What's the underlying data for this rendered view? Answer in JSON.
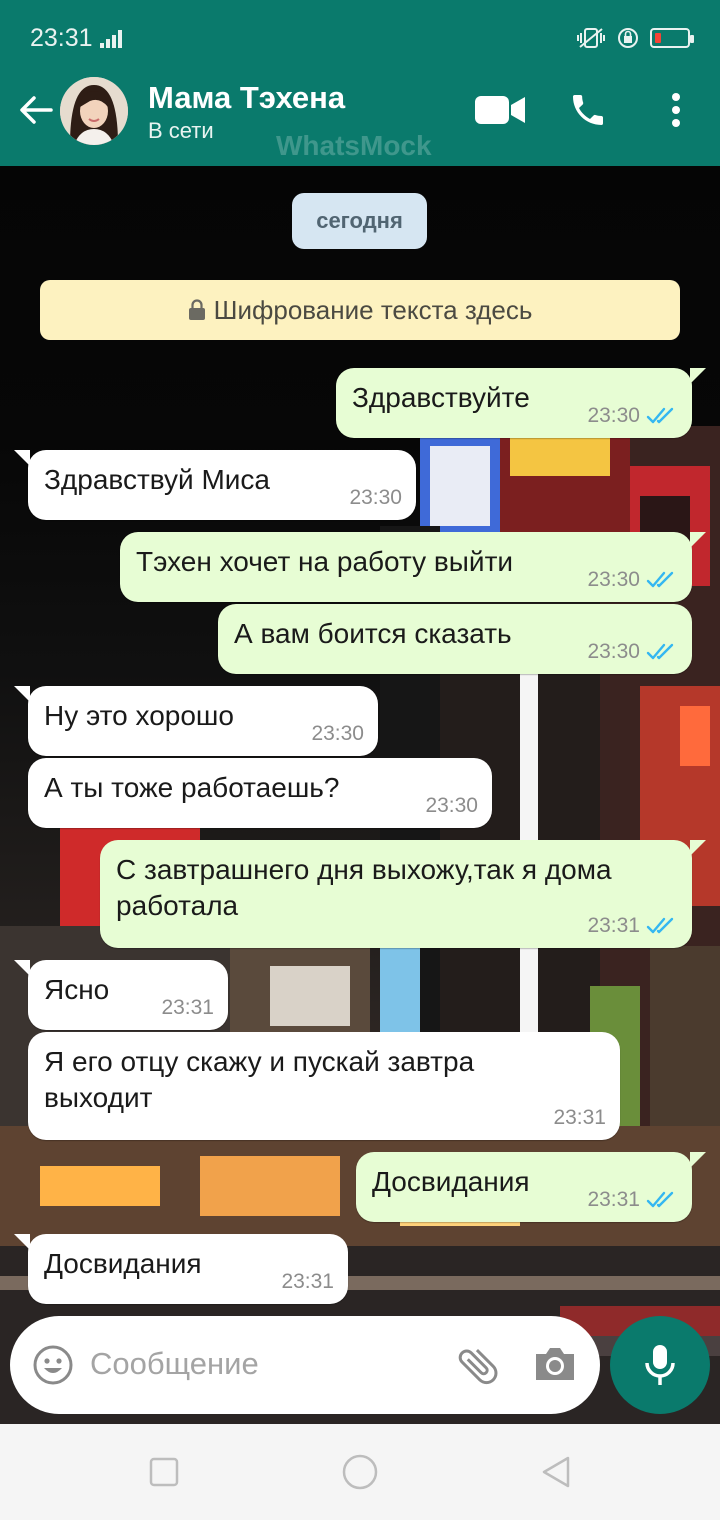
{
  "status_bar": {
    "time": "23:31"
  },
  "header": {
    "contact_name": "Мама Тэхена",
    "contact_status": "В сети",
    "watermark": "WhatsMock"
  },
  "chat": {
    "date_label": "сегодня",
    "encryption_notice": "Шифрование текста здесь",
    "messages": [
      {
        "dir": "out",
        "text": "Здравствуйте",
        "time": "23:30"
      },
      {
        "dir": "in",
        "text": "Здравствуй Миса",
        "time": "23:30"
      },
      {
        "dir": "out",
        "text": "Тэхен хочет на работу выйти",
        "time": "23:30"
      },
      {
        "dir": "out",
        "text": "А вам боится сказать",
        "time": "23:30"
      },
      {
        "dir": "in",
        "text": "Ну это хорошо",
        "time": "23:30"
      },
      {
        "dir": "in",
        "text": "А ты тоже работаешь?",
        "time": "23:30"
      },
      {
        "dir": "out",
        "text": "С завтрашнего дня выхожу,так я дома работала",
        "time": "23:31"
      },
      {
        "dir": "in",
        "text": "Ясно",
        "time": "23:31"
      },
      {
        "dir": "in",
        "text": "Я его отцу скажу и пускай завтра выходит",
        "time": "23:31"
      },
      {
        "dir": "out",
        "text": "Досвидания",
        "time": "23:31"
      },
      {
        "dir": "in",
        "text": "Досвидания",
        "time": "23:31"
      }
    ]
  },
  "input": {
    "placeholder": "Сообщение"
  },
  "colors": {
    "header": "#0a7a6c",
    "outgoing_bubble": "#e7fdd4",
    "incoming_bubble": "#ffffff",
    "read_ticks": "#34b7f1"
  },
  "icons": [
    "back-arrow-icon",
    "video-call-icon",
    "phone-icon",
    "more-vert-icon",
    "lock-icon",
    "emoji-icon",
    "attach-icon",
    "camera-icon",
    "mic-icon",
    "double-check-icon"
  ]
}
